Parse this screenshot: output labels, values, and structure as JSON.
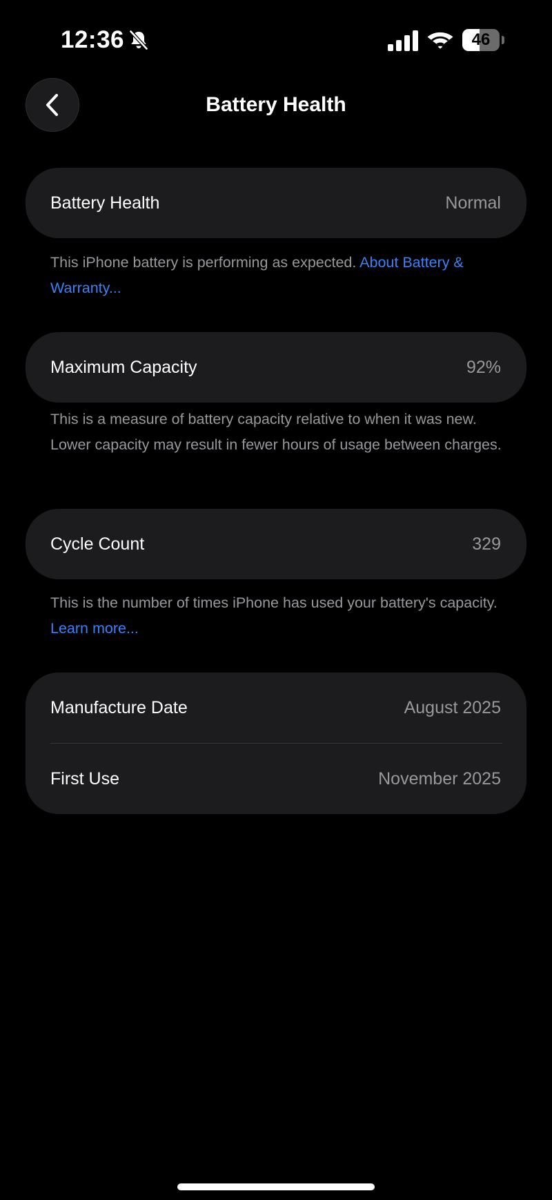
{
  "status_bar": {
    "time": "12:36",
    "battery_level": "46",
    "battery_fraction": 0.46,
    "icons": [
      "bell-slash-icon",
      "cellular-signal-icon",
      "wifi-icon",
      "battery-icon"
    ]
  },
  "nav": {
    "title": "Battery Health",
    "back_icon": "chevron-left-icon"
  },
  "sections": {
    "health": {
      "label": "Battery Health",
      "value": "Normal",
      "footnote": "This iPhone battery is performing as expected.",
      "link": "About Battery & Warranty..."
    },
    "capacity": {
      "label": "Maximum Capacity",
      "value": "92%",
      "footnote": "This is a measure of battery capacity relative to when it was new. Lower capacity may result in fewer hours of usage between charges."
    },
    "cycles": {
      "label": "Cycle Count",
      "value": "329",
      "footnote": "This is the number of times iPhone has used your battery's capacity.",
      "link": "Learn more..."
    },
    "dates": {
      "manufacture_label": "Manufacture Date",
      "manufacture_value": "August 2025",
      "first_use_label": "First Use",
      "first_use_value": "November 2025"
    }
  },
  "colors": {
    "background": "#000000",
    "card": "#1c1c1e",
    "secondary_text": "#98989d",
    "link": "#3a82f7"
  }
}
